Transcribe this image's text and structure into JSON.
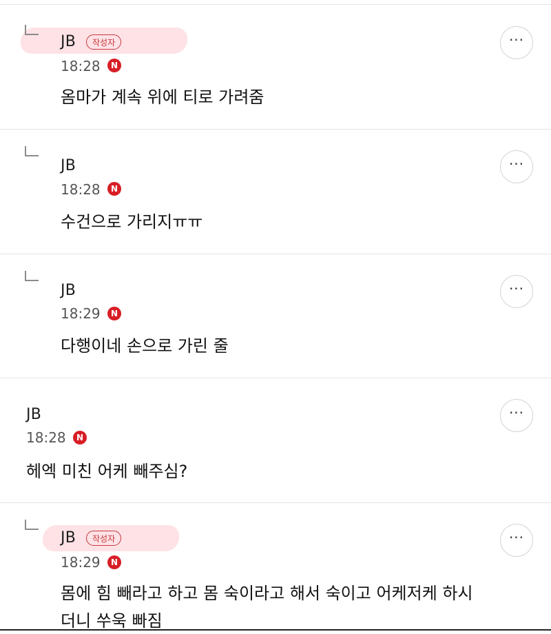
{
  "author_badge_label": "작성자",
  "new_badge_label": "N",
  "more_button_label": "···",
  "comments": [
    {
      "author": "JB",
      "time": "18:28",
      "is_reply": true,
      "is_author": true,
      "text": [
        "옴마가 계속 위에 티로 가려줌"
      ]
    },
    {
      "author": "JB",
      "time": "18:28",
      "is_reply": true,
      "is_author": false,
      "text": [
        "수건으로 가리지ㅠㅠ"
      ]
    },
    {
      "author": "JB",
      "time": "18:29",
      "is_reply": true,
      "is_author": false,
      "text": [
        "다행이네 손으로 가린 줄"
      ]
    },
    {
      "author": "JB",
      "time": "18:28",
      "is_reply": false,
      "is_author": false,
      "text": [
        "헤엑 미친 어케 빼주심?"
      ]
    },
    {
      "author": "JB",
      "time": "18:29",
      "is_reply": true,
      "is_author": true,
      "text": [
        "몸에 힘 빼라고 하고 몸 숙이라고 해서 숙이고 어케저케 하시",
        "더니 쑤욱 빠짐"
      ]
    }
  ]
}
